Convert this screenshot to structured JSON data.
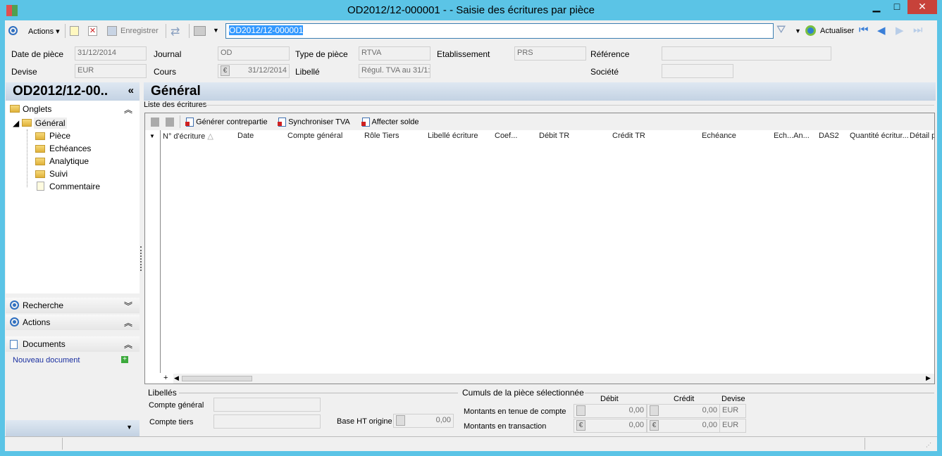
{
  "window": {
    "title": "OD2012/12-000001 -  -  Saisie des écritures par pièce",
    "minimize": "▁",
    "maximize": "□",
    "close": "✕"
  },
  "toolbar": {
    "actions": "Actions",
    "save": "Enregistrer",
    "search_value": "OD2012/12-000001",
    "refresh": "Actualiser"
  },
  "form": {
    "date_piece_label": "Date de pièce",
    "date_piece": "31/12/2014",
    "journal_label": "Journal",
    "journal": "OD",
    "type_piece_label": "Type de pièce",
    "type_piece": "RTVA",
    "etablissement_label": "Etablissement",
    "etablissement": "PRS",
    "reference_label": "Référence",
    "reference": "",
    "devise_label": "Devise",
    "devise": "EUR",
    "cours_label": "Cours",
    "cours": "31/12/2014",
    "libelle_label": "Libellé",
    "libelle": "Régul. TVA au 31/1:",
    "societe_label": "Société",
    "societe": ""
  },
  "sidebar": {
    "title": "OD2012/12-00..",
    "onglets": "Onglets",
    "tree": {
      "root": "Général",
      "children": [
        "Pièce",
        "Echéances",
        "Analytique",
        "Suivi",
        "Commentaire"
      ]
    },
    "recherche": "Recherche",
    "actions": "Actions",
    "documents": "Documents",
    "new_document": "Nouveau document"
  },
  "main": {
    "title": "Général",
    "list_label": "Liste des écritures",
    "buttons": [
      "Générer contrepartie",
      "Synchroniser TVA",
      "Affecter solde"
    ],
    "columns": [
      "N° d'écriture",
      "Date",
      "Compte général",
      "Rôle Tiers",
      "Libellé écriture",
      "Coef...",
      "Débit TR",
      "Crédit TR",
      "Echéance",
      "Ech...An...",
      "DAS2",
      "Quantité écritur...",
      "Détail p"
    ]
  },
  "libelles": {
    "title": "Libellés",
    "compte_general": "Compte général",
    "compte_tiers": "Compte tiers",
    "base_ht": "Base HT origine",
    "base_ht_value": "0,00"
  },
  "cumuls": {
    "title": "Cumuls de la pièce sélectionnée",
    "debit": "Débit",
    "credit": "Crédit",
    "devise": "Devise",
    "rows": [
      {
        "label": "Montants en tenue de compte",
        "debit": "0,00",
        "credit": "0,00",
        "devise": "EUR"
      },
      {
        "label": "Montants en transaction",
        "debit": "0,00",
        "credit": "0,00",
        "devise": "EUR"
      }
    ]
  }
}
